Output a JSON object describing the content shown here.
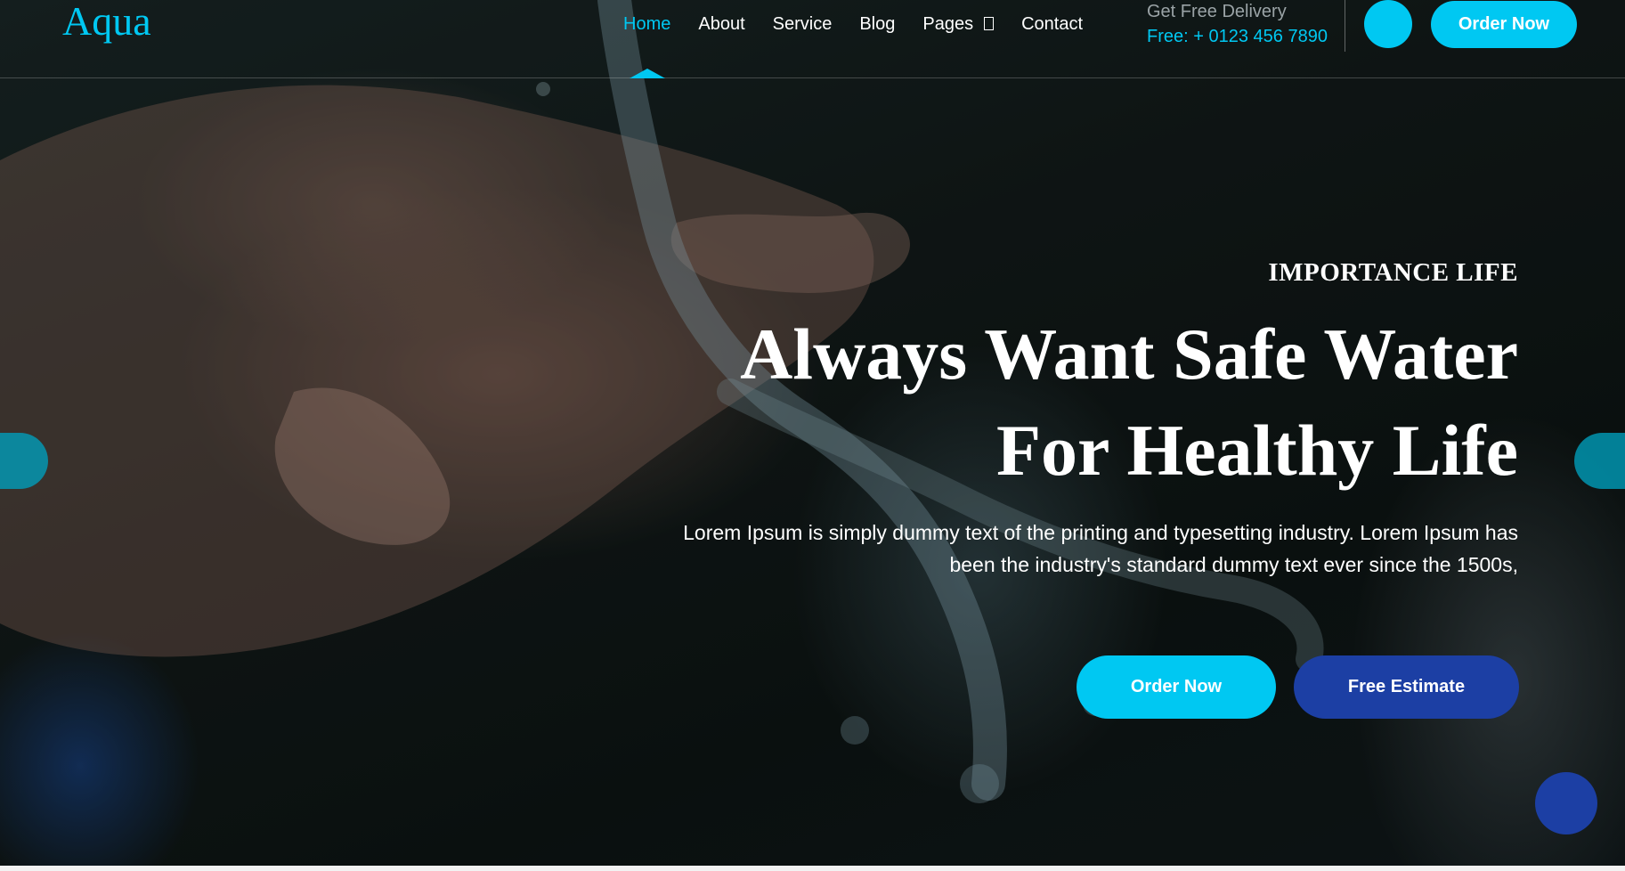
{
  "brand": {
    "logo": "Aqua"
  },
  "nav": {
    "items": [
      {
        "label": "Home",
        "active": true
      },
      {
        "label": "About"
      },
      {
        "label": "Service"
      },
      {
        "label": "Blog"
      },
      {
        "label": "Pages",
        "has_dropdown": true
      },
      {
        "label": "Contact"
      }
    ]
  },
  "delivery": {
    "label": "Get Free Delivery",
    "phone": "Free: + 0123 456 7890"
  },
  "header": {
    "order_label": "Order Now"
  },
  "hero": {
    "eyebrow": "IMPORTANCE LIFE",
    "headline_line1": "Always Want Safe Water",
    "headline_line2": "For Healthy Life",
    "description": "Lorem Ipsum is simply dummy text of the printing and typesetting industry. Lorem Ipsum has been the industry's standard dummy text ever since the 1500s,",
    "primary_button": "Order Now",
    "secondary_button": "Free Estimate"
  },
  "colors": {
    "accent": "#00c8f2",
    "secondary": "#1c3fa4",
    "text": "#ffffff"
  },
  "icons": {
    "pages_dropdown": "chevron-down-icon"
  }
}
